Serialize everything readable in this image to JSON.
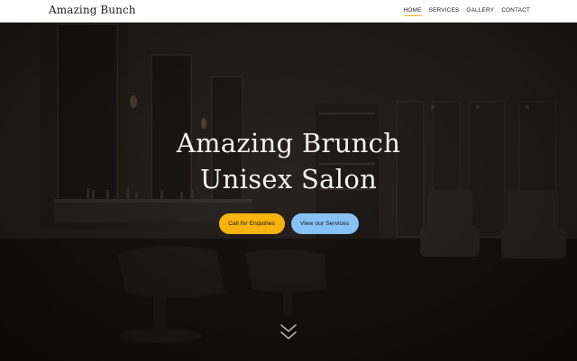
{
  "header": {
    "logo": "Amazing Bunch",
    "nav": [
      {
        "label": "HOME",
        "active": true
      },
      {
        "label": "SERVICES",
        "active": false
      },
      {
        "label": "GALLERY",
        "active": false
      },
      {
        "label": "CONTACT",
        "active": false
      }
    ]
  },
  "hero": {
    "title_line1": "Amazing Brunch",
    "title_line2": "Unisex Salon",
    "cta_primary": "Call for Enquiries",
    "cta_secondary": "View our Services",
    "scroll_icon": "double-chevron-down-icon"
  },
  "colors": {
    "accent": "#f7b30f",
    "secondary_button": "#86c2f4",
    "nav_active_underline": "#f2b21e",
    "header_bg": "#ffffff"
  }
}
